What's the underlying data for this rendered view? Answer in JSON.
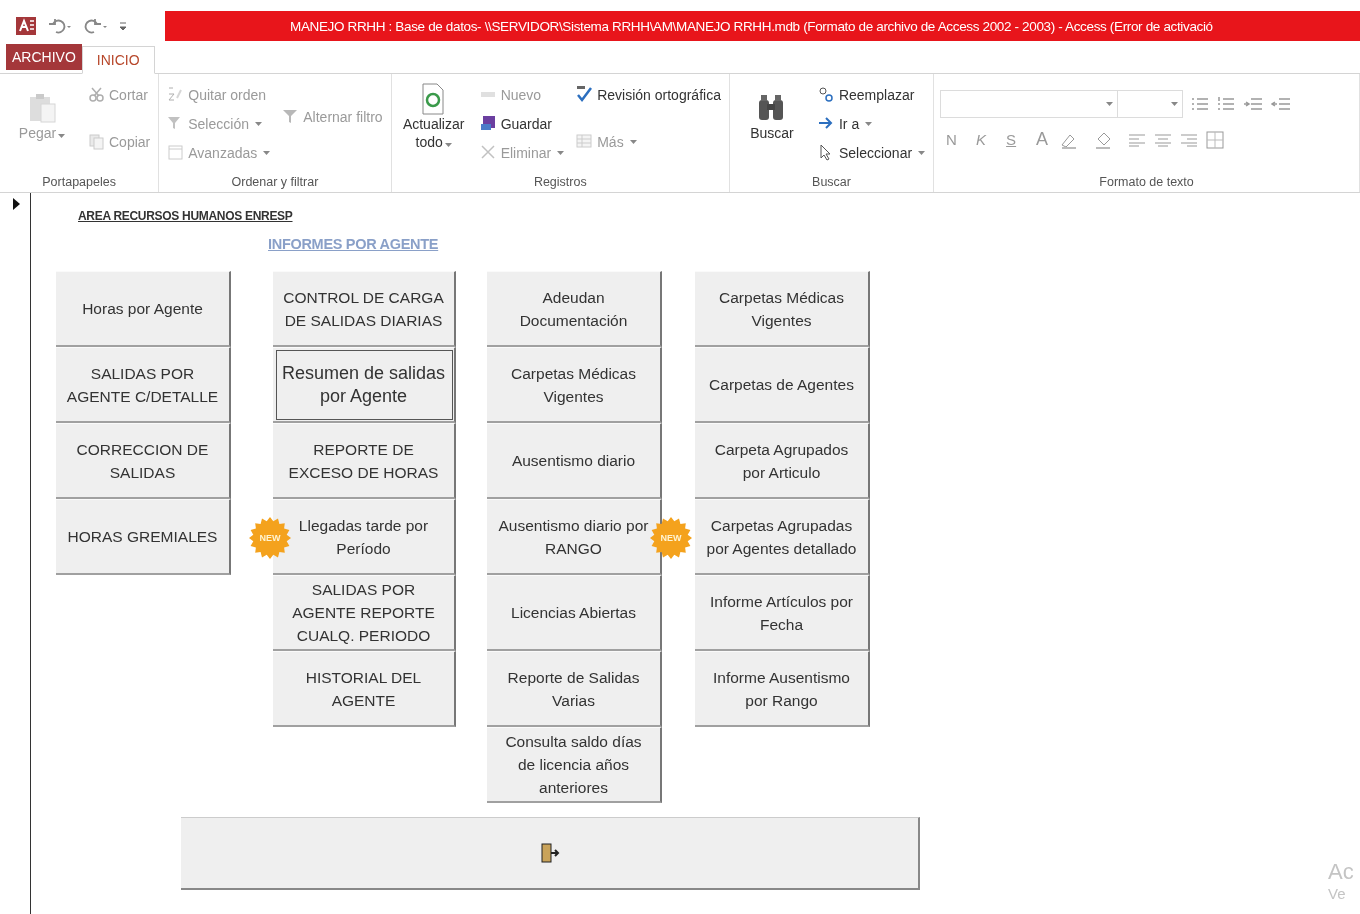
{
  "title_bar": {
    "title": "MANEJO RRHH : Base de datos- \\\\SERVIDOR\\Sistema RRHH\\AM\\MANEJO RRHH.mdb (Formato de archivo de Access 2002 - 2003) -  Access (Error de activació"
  },
  "tabs": [
    {
      "label": "ARCHIVO",
      "kind": "file",
      "selected": false
    },
    {
      "label": "INICIO",
      "kind": "tab",
      "selected": true
    }
  ],
  "ribbon": {
    "groups": [
      {
        "label": "Portapapeles",
        "kind": "items",
        "columns": [
          [
            {
              "label": "Pegar",
              "kind": "large",
              "disabled": true,
              "dropdown": true
            }
          ],
          [
            {
              "label": "Cortar",
              "kind": "small",
              "disabled": true,
              "dropdown": false
            },
            {
              "label": "Copiar",
              "kind": "small",
              "disabled": true,
              "dropdown": false
            }
          ]
        ]
      },
      {
        "label": "Ordenar y filtrar",
        "kind": "items",
        "columns": [
          [
            {
              "label": "Quitar orden",
              "kind": "small",
              "disabled": true,
              "dropdown": false
            },
            {
              "label": "Selección",
              "kind": "small",
              "disabled": true,
              "dropdown": true
            },
            {
              "label": "Avanzadas",
              "kind": "small",
              "disabled": true,
              "dropdown": true
            }
          ],
          [
            {
              "label": "Alternar filtro",
              "kind": "small",
              "disabled": true,
              "dropdown": false
            }
          ]
        ]
      },
      {
        "label": "Registros",
        "kind": "items",
        "columns": [
          [
            {
              "label": "Actualizar todo",
              "kind": "large",
              "disabled": false,
              "dropdown": true
            }
          ],
          [
            {
              "label": "Nuevo",
              "kind": "small",
              "disabled": true,
              "dropdown": false
            },
            {
              "label": "Guardar",
              "kind": "small",
              "disabled": false,
              "dropdown": false
            },
            {
              "label": "Eliminar",
              "kind": "small",
              "disabled": true,
              "dropdown": true
            }
          ],
          [
            {
              "label": "Revisión ortográfica",
              "kind": "small",
              "disabled": false,
              "dropdown": false
            },
            {
              "label": "Más",
              "kind": "small",
              "disabled": true,
              "dropdown": true
            }
          ]
        ]
      },
      {
        "label": "Buscar",
        "kind": "items",
        "columns": [
          [
            {
              "label": "Buscar",
              "kind": "large",
              "disabled": false,
              "dropdown": false
            }
          ],
          [
            {
              "label": "Reemplazar",
              "kind": "small",
              "disabled": false,
              "dropdown": false
            },
            {
              "label": "Ir a",
              "kind": "small",
              "disabled": false,
              "dropdown": true
            },
            {
              "label": "Seleccionar",
              "kind": "small",
              "disabled": false,
              "dropdown": true
            }
          ]
        ]
      },
      {
        "label": "Formato de texto",
        "kind": "format",
        "letters": [
          {
            "label": "N",
            "kind": "bold",
            "disabled": true
          },
          {
            "label": "K",
            "kind": "italic",
            "disabled": true
          },
          {
            "label": "S",
            "kind": "underline",
            "disabled": true
          },
          {
            "label": "A",
            "kind": "color",
            "disabled": true
          }
        ]
      }
    ]
  },
  "form": {
    "heading": "AREA RECURSOS HUMANOS ENRESP",
    "subheading": "INFORMES POR AGENTE",
    "columns": [
      [
        {
          "label": "Horas por Agente",
          "focused": false
        },
        {
          "label": "SALIDAS POR AGENTE C/DETALLE",
          "focused": false
        },
        {
          "label": "CORRECCION DE SALIDAS",
          "focused": false
        },
        {
          "label": "HORAS GREMIALES",
          "focused": false
        }
      ],
      [
        {
          "label": "CONTROL DE CARGA DE SALIDAS DIARIAS",
          "focused": false
        },
        {
          "label": "Resumen de salidas por Agente",
          "focused": true
        },
        {
          "label": "REPORTE DE EXCESO DE HORAS",
          "focused": false
        },
        {
          "label": "Llegadas tarde por Período",
          "focused": false,
          "badge": "NEW"
        },
        {
          "label": "SALIDAS POR AGENTE REPORTE CUALQ. PERIODO",
          "focused": false
        },
        {
          "label": "HISTORIAL DEL AGENTE",
          "focused": false
        }
      ],
      [
        {
          "label": "Adeudan Documentación",
          "focused": false
        },
        {
          "label": "Carpetas Médicas Vigentes",
          "focused": false
        },
        {
          "label": "Ausentismo diario",
          "focused": false
        },
        {
          "label": "Ausentismo diario por RANGO",
          "focused": false,
          "badge": "NEW"
        },
        {
          "label": "Licencias Abiertas",
          "focused": false
        },
        {
          "label": "Reporte de Salidas Varias",
          "focused": false
        },
        {
          "label": "Consulta saldo días de licencia años anteriores",
          "focused": false
        }
      ],
      [
        {
          "label": "Carpetas Médicas Vigentes",
          "focused": false
        },
        {
          "label": "Carpetas de Agentes",
          "focused": false
        },
        {
          "label": "Carpeta Agrupados por Articulo",
          "focused": false
        },
        {
          "label": "Carpetas Agrupadas por Agentes detallado",
          "focused": false
        },
        {
          "label": "Informe Artículos por Fecha",
          "focused": false
        },
        {
          "label": "Informe Ausentismo por Rango",
          "focused": false
        }
      ]
    ]
  },
  "os_watermark": [
    "Ac",
    "Ve"
  ]
}
